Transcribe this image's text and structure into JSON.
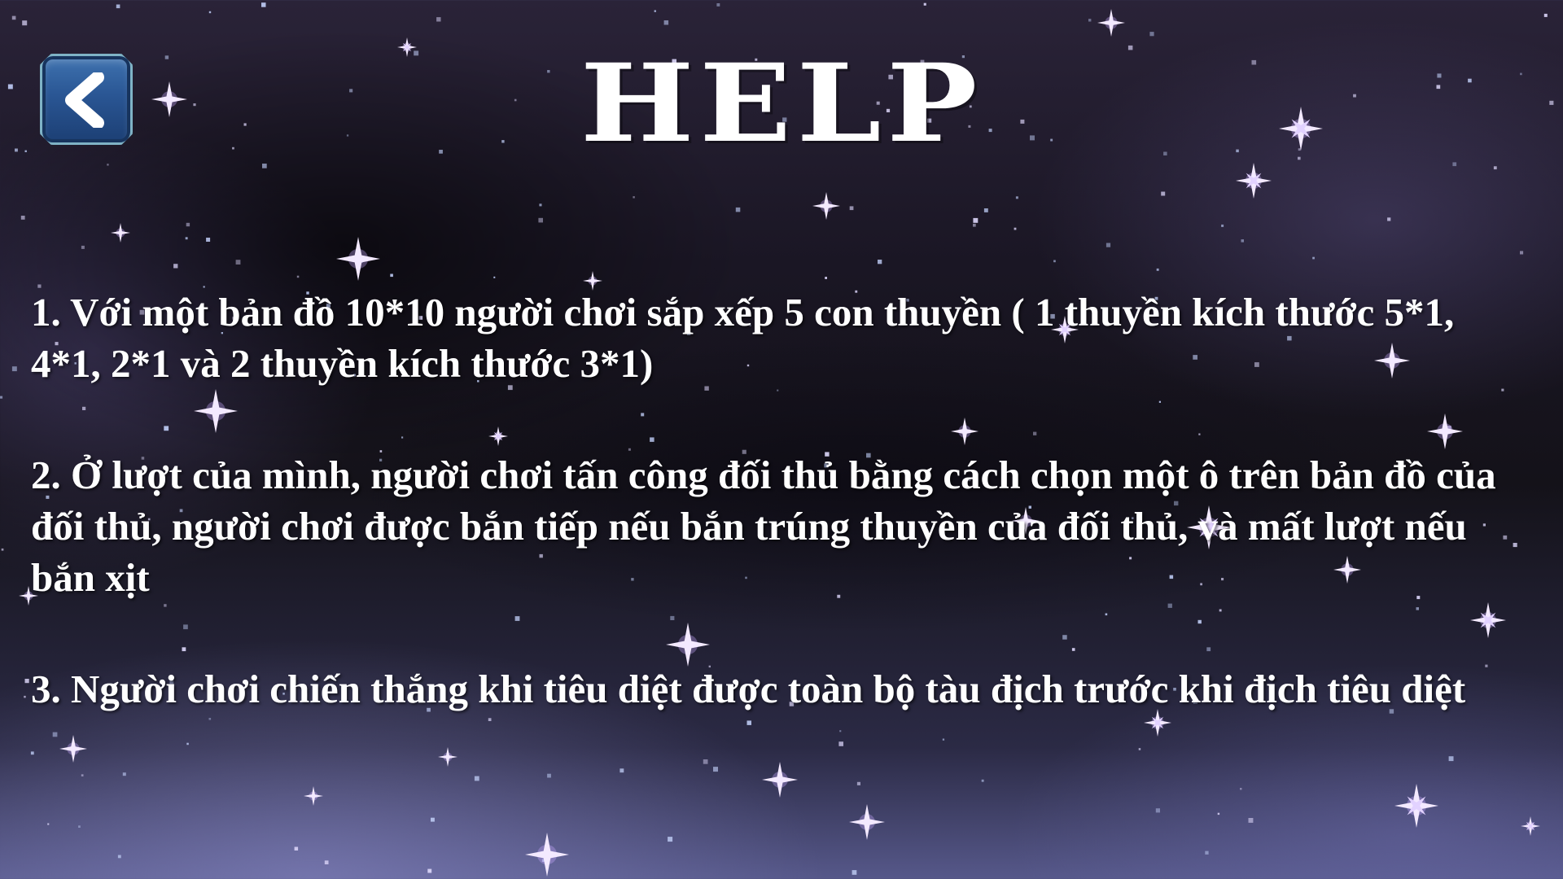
{
  "screen": {
    "title": "HELP",
    "back_button_icon": "chevron-left-icon"
  },
  "rules": [
    "1. Với một bản đồ 10*10 người chơi sắp xếp 5 con thuyền ( 1 thuyền kích thước 5*1,  4*1, 2*1 và 2 thuyền kích thước 3*1)",
    "2. Ở lượt của mình, người chơi tấn công đối thủ bằng cách chọn một ô trên bản đồ của đối thủ, người chơi được bắn tiếp nếu bắn trúng thuyền của đối thủ, và mất lượt nếu bắn xịt",
    "3. Người chơi chiến thắng khi tiêu diệt được toàn bộ tàu địch trước khi địch tiêu diệt"
  ],
  "colors": {
    "text": "#ffffff",
    "button_fill": "#2a5694",
    "button_border": "#7fb3c6",
    "star": "#e9dcff"
  }
}
